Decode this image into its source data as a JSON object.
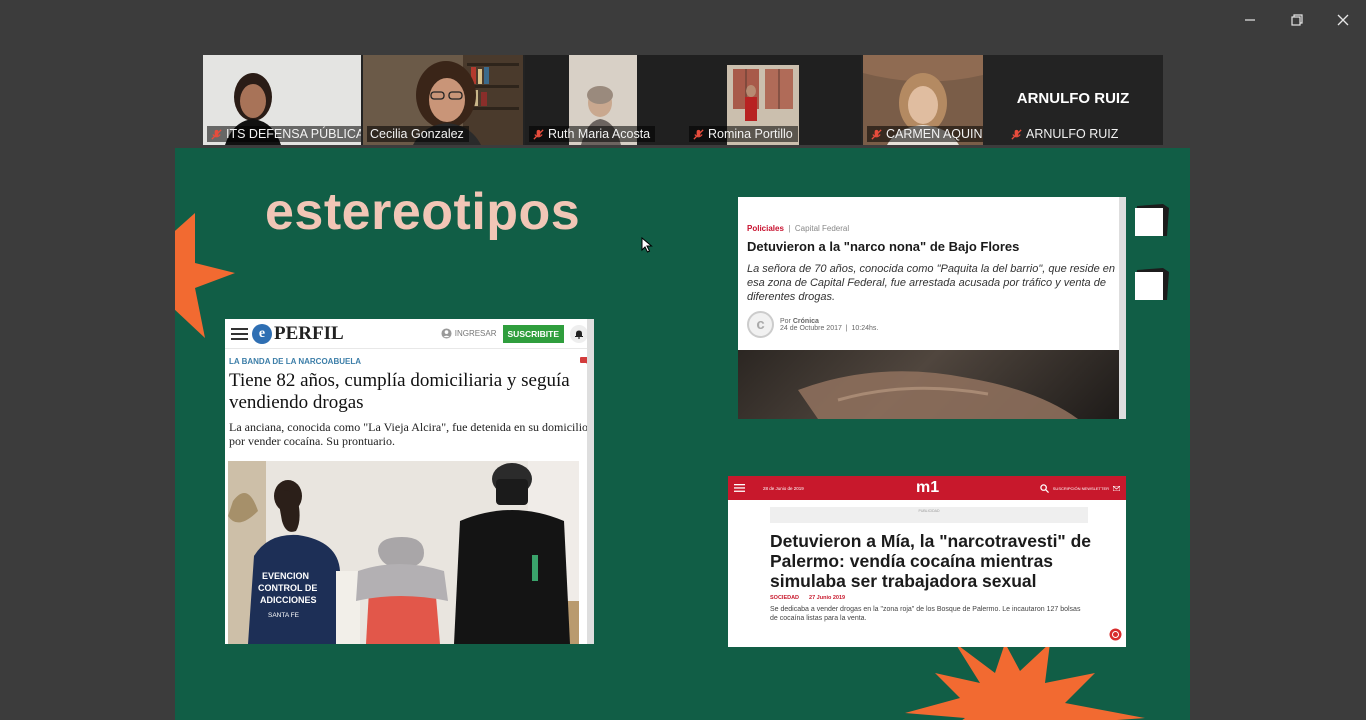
{
  "window": {
    "minimize_icon": "minimize-icon",
    "restore_icon": "restore-icon",
    "close_icon": "close-icon"
  },
  "participants": [
    {
      "name": "ITS DEFENSA PÚBLICA",
      "muted": true
    },
    {
      "name": "Cecilia Gonzalez",
      "muted": false,
      "active": true
    },
    {
      "name": "Ruth Maria Acosta",
      "muted": true
    },
    {
      "name": "Romina Portillo",
      "muted": true
    },
    {
      "name": "CARMEN AQUINO",
      "muted": true
    },
    {
      "name": "ARNULFO RUIZ",
      "muted": true,
      "video_off": true,
      "display_name": "ARNULFO RUIZ"
    }
  ],
  "slide": {
    "title": "estereotipos",
    "colors": {
      "background": "#115e46",
      "title": "#f1c6b6",
      "accent": "#f26a31"
    }
  },
  "articles": {
    "perfil": {
      "logo_text": "PERFIL",
      "ingresar": "INGRESAR",
      "subscribe": "SUSCRIBITE",
      "kicker": "LA BANDA DE LA NARCOABUELA",
      "headline": "Tiene 82 años, cumplía domiciliaria y seguía vendiendo drogas",
      "subhead": "La anciana, conocida como \"La Vieja Alcira\", fue detenida en su domicilio por vender cocaína. Su prontuario.",
      "vest_text": [
        "EVENCION",
        "CONTROL DE",
        "ADICCIONES",
        "SANTA FE"
      ]
    },
    "cronica": {
      "section": "Policiales",
      "subsection": "Capital Federal",
      "headline": "Detuvieron a la \"narco nona\" de Bajo Flores",
      "subhead": "La señora de 70 años, conocida como \"Paquita la del barrio\", que reside en esa zona de Capital Federal, fue arrestada acusada por tráfico y venta de diferentes drogas.",
      "by_prefix": "Por",
      "by": "Crónica",
      "date": "24 de Octubre 2017",
      "time": "10:24hs."
    },
    "m1": {
      "logo": "m1",
      "date": "28 de Junio de 2019",
      "newsletter": "SUSCRIPCIÓN NEWSLETTER",
      "ad_label": "PUBLICIDAD",
      "headline": "Detuvieron a Mía, la \"narcotravesti\" de Palermo: vendía cocaína mientras simulaba ser trabajadora sexual",
      "section": "SOCIEDAD",
      "date_short": "27 Junio 2019",
      "subhead": "Se dedicaba a vender drogas en la \"zona roja\" de los Bosque de Palermo. Le incautaron 127 bolsas de cocaína listas para la venta."
    }
  }
}
